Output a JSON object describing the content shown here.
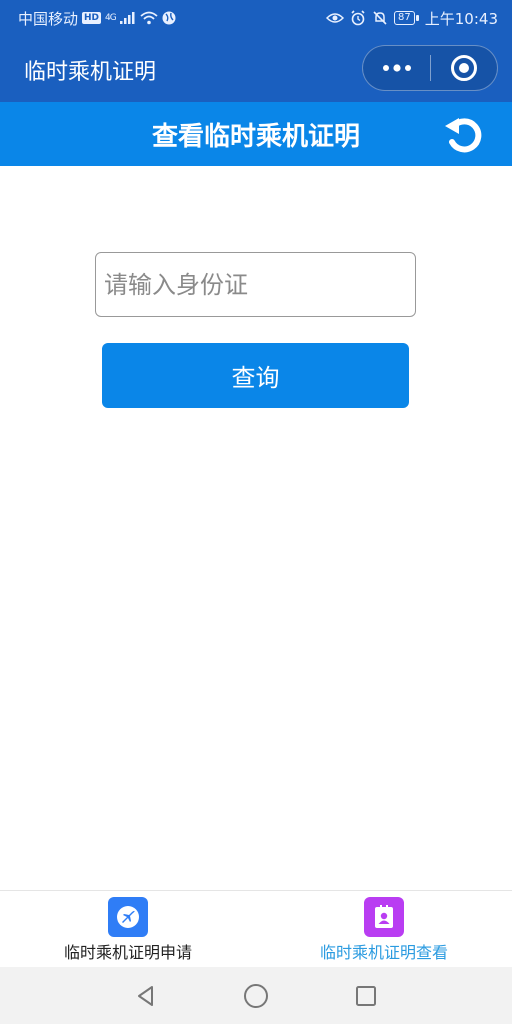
{
  "status_bar": {
    "carrier": "中国移动",
    "hd_badge": "HD",
    "network": "4G",
    "battery": "87",
    "time": "上午10:43"
  },
  "nav": {
    "title": "临时乘机证明",
    "more_icon": "more-dots-icon",
    "close_icon": "target-circle-icon"
  },
  "header": {
    "title": "查看临时乘机证明",
    "refresh_icon": "refresh-icon"
  },
  "form": {
    "id_placeholder": "请输入身份证",
    "id_value": "",
    "query_label": "查询"
  },
  "tabbar": {
    "items": [
      {
        "label": "临时乘机证明申请",
        "icon": "airplane-icon",
        "icon_color": "#2f7df6",
        "active": false
      },
      {
        "label": "临时乘机证明查看",
        "icon": "id-card-icon",
        "icon_color": "#b93df2",
        "active": true
      }
    ],
    "active_color": "#2b9be0"
  },
  "colors": {
    "nav_bg": "#1a5fbf",
    "primary": "#0a86e8"
  }
}
